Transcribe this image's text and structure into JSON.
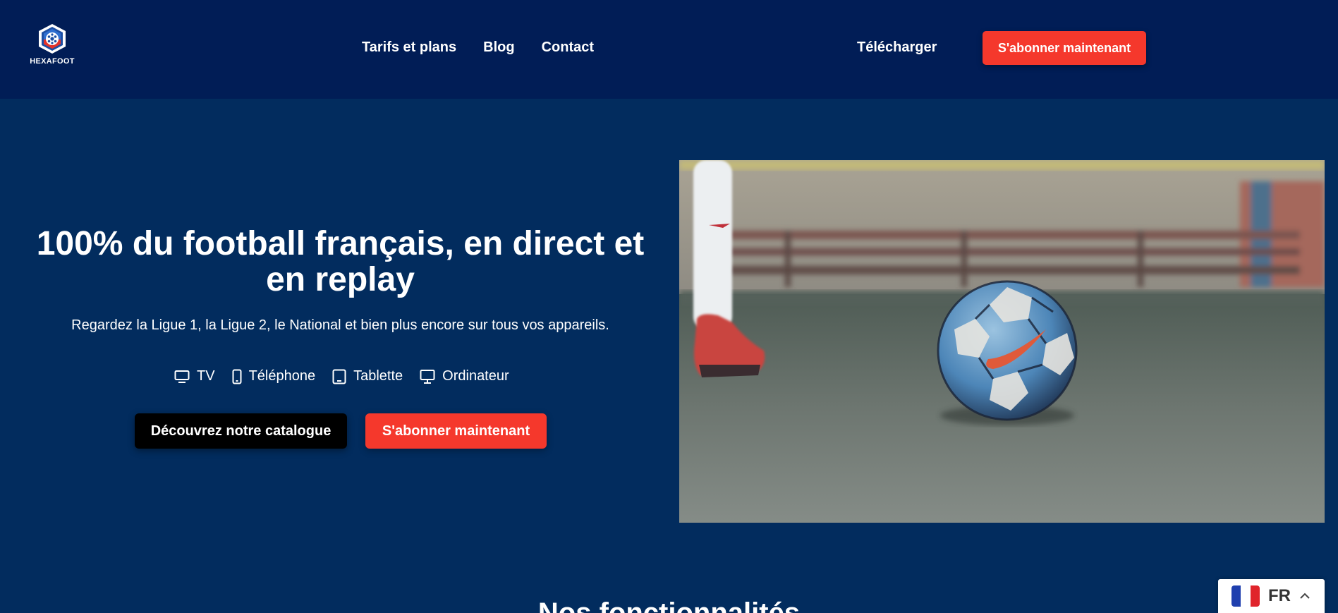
{
  "brand": {
    "name": "HEXAFOOT"
  },
  "header": {
    "nav": [
      {
        "label": "Tarifs et plans"
      },
      {
        "label": "Blog"
      },
      {
        "label": "Contact"
      }
    ],
    "download_label": "Télécharger",
    "cta_label": "S'abonner maintenant"
  },
  "hero": {
    "title": "100% du football français, en direct et en replay",
    "subtitle": "Regardez la Ligue 1, la Ligue 2, le National et bien plus encore sur tous vos appareils.",
    "devices": [
      {
        "icon": "tv-icon",
        "label": "TV"
      },
      {
        "icon": "phone-icon",
        "label": "Téléphone"
      },
      {
        "icon": "tablet-icon",
        "label": "Tablette"
      },
      {
        "icon": "desktop-icon",
        "label": "Ordinateur"
      }
    ],
    "catalog_button": "Découvrez notre catalogue",
    "subscribe_button": "S'abonner maintenant"
  },
  "features": {
    "title": "Nos fonctionnalités"
  },
  "language": {
    "code": "FR",
    "flag": "france-flag-icon"
  },
  "colors": {
    "header_bg": "#011d56",
    "page_bg": "#022c5e",
    "accent": "#f5382c",
    "dark_button": "#000000"
  }
}
